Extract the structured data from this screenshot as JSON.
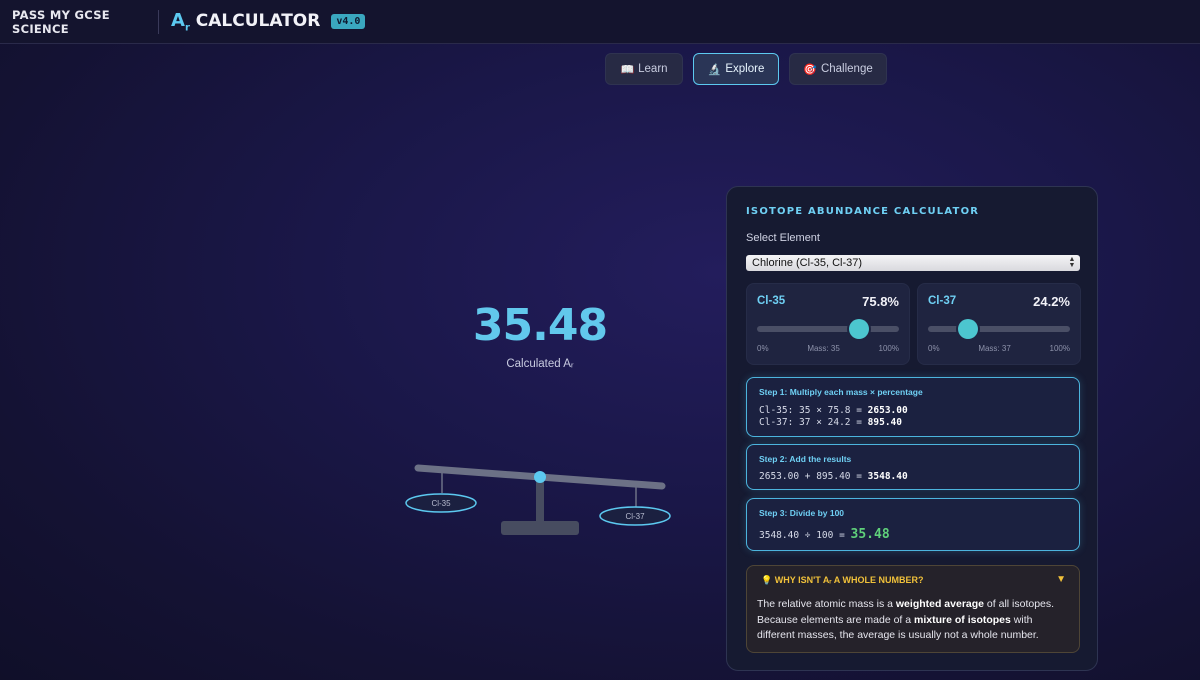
{
  "header": {
    "brand": "PASS MY GCSE SCIENCE",
    "title_prefix": "A",
    "title_sub": "r",
    "title_main": "CALCULATOR",
    "version": "v4.0"
  },
  "tabs": [
    {
      "icon": "📖",
      "label": "Learn",
      "active": false
    },
    {
      "icon": "🔬",
      "label": "Explore",
      "active": true
    },
    {
      "icon": "🎯",
      "label": "Challenge",
      "active": false
    }
  ],
  "result": {
    "value": "35.48",
    "label": "Calculated Aᵣ"
  },
  "scale": {
    "left_pan": "Cl-35",
    "right_pan": "Cl-37"
  },
  "panel": {
    "title": "ISOTOPE ABUNDANCE CALCULATOR",
    "select_label": "Select Element",
    "select_value": "Chlorine (Cl-35, Cl-37)",
    "isotopes": [
      {
        "name": "Cl-35",
        "percent": "75.8%",
        "abundance": 75.8,
        "min": "0%",
        "mass": "Mass: 35",
        "max": "100%"
      },
      {
        "name": "Cl-37",
        "percent": "24.2%",
        "abundance": 24.2,
        "min": "0%",
        "mass": "Mass: 37",
        "max": "100%"
      }
    ],
    "steps": [
      {
        "heading": "Step 1: Multiply each mass × percentage",
        "lines": [
          {
            "expr": "Cl-35: 35 × 75.8 = ",
            "result": "2653.00"
          },
          {
            "expr": "Cl-37: 37 × 24.2 = ",
            "result": "895.40"
          }
        ]
      },
      {
        "heading": "Step 2: Add the results",
        "lines": [
          {
            "expr": "2653.00 + 895.40 = ",
            "result": "3548.40"
          }
        ]
      },
      {
        "heading": "Step 3: Divide by 100",
        "lines": [
          {
            "expr": "3548.40 ÷ 100 = ",
            "result": "35.48"
          }
        ]
      }
    ],
    "why": {
      "icon": "💡",
      "heading": "WHY ISN'T Aᵣ A WHOLE NUMBER?",
      "toggle": "▼",
      "body_1": "The relative atomic mass is a ",
      "body_b1": "weighted average",
      "body_2": " of all isotopes. Because elements are made of a ",
      "body_b2": "mixture of isotopes",
      "body_3": " with different masses, the average is usually not a whole number."
    }
  },
  "colors": {
    "accent": "#5cc9f0",
    "result_green": "#5fd07a",
    "warning": "#f1c13a",
    "thumb": "#4cc6cf"
  }
}
